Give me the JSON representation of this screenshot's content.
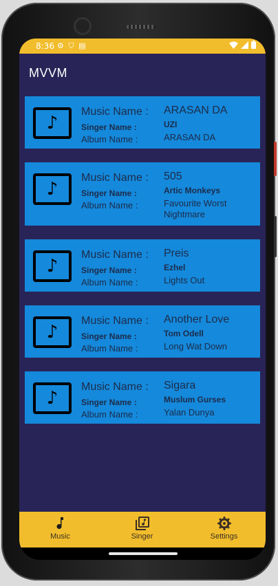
{
  "status_bar": {
    "time": "8:36",
    "left_icons": [
      "gear-icon",
      "shield-icon",
      "sd-card-icon"
    ],
    "right_icons": [
      "wifi-icon",
      "signal-icon",
      "battery-icon"
    ]
  },
  "appbar": {
    "title": "MVVM"
  },
  "labels": {
    "music_name": "Music Name :",
    "singer_name": "Singer Name :",
    "album_name": "Album Name :"
  },
  "songs": [
    {
      "music": "ARASAN DA",
      "singer": "UZI",
      "album": "ARASAN DA"
    },
    {
      "music": "505",
      "singer": "Artic Monkeys",
      "album": "Favourite Worst Nightmare"
    },
    {
      "music": "Preis",
      "singer": "Ezhel",
      "album": "Lights Out"
    },
    {
      "music": "Another Love",
      "singer": "Tom Odell",
      "album": "Long Wat Down"
    },
    {
      "music": "Sigara",
      "singer": "Muslum Gurses",
      "album": "Yalan Dunya"
    }
  ],
  "bottom_nav": [
    {
      "label": "Music",
      "icon": "music-note-icon",
      "selected": true
    },
    {
      "label": "Singer",
      "icon": "library-music-icon",
      "selected": false
    },
    {
      "label": "Settings",
      "icon": "gear-icon",
      "selected": false
    }
  ],
  "colors": {
    "accent": "#f2bd2c",
    "background": "#282457",
    "card": "#1589db",
    "text_dark": "#1c2b4a"
  }
}
